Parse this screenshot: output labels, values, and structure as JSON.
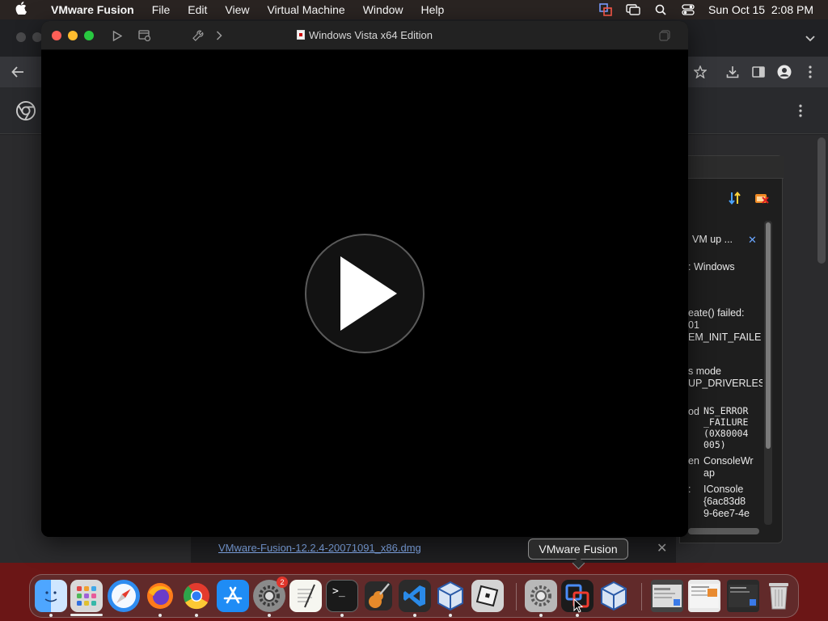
{
  "menubar": {
    "app_name": "VMware Fusion",
    "items": [
      "File",
      "Edit",
      "View",
      "Virtual Machine",
      "Window",
      "Help"
    ],
    "clock": "Sun Oct 15  2:08 PM"
  },
  "vmware_window": {
    "title": "Windows Vista x64 Edition"
  },
  "vbox_log": {
    "lines": [
      "VM up ...",
      ": Windows",
      "eate() failed:",
      "01",
      "EM_INIT_FAILE",
      "s mode",
      "UP_DRIVERLES",
      "od",
      "NS_ERROR",
      "_FAILURE",
      "(0X80004",
      "005)",
      "en",
      "ConsoleWr",
      "ap",
      ":",
      "IConsole",
      "{6ac83d8",
      "9-6ee7-4e"
    ]
  },
  "downloads": {
    "file_name": "VMware-Fusion-12.2.4-20071091_x86.dmg"
  },
  "tooltip": {
    "text": "VMware Fusion"
  },
  "dock": {
    "settings_badge": "2"
  }
}
